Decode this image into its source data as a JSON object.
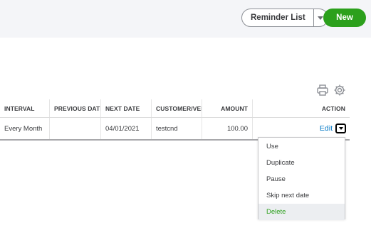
{
  "header": {
    "reminder_label": "Reminder List",
    "new_label": "New"
  },
  "table": {
    "columns": [
      "INTERVAL",
      "PREVIOUS DATE",
      "NEXT DATE",
      "CUSTOMER/VENDOR",
      "AMOUNT",
      "ACTION"
    ],
    "rows": [
      {
        "interval": "Every Month",
        "previous_date": "",
        "next_date": "04/01/2021",
        "customer": "testcnd",
        "amount": "100.00",
        "action": "Edit"
      }
    ]
  },
  "menu": {
    "items": [
      "Use",
      "Duplicate",
      "Pause",
      "Skip next date",
      "Delete"
    ],
    "highlighted": "Delete"
  },
  "colors": {
    "accent": "#2ca01c",
    "link": "#0077c5"
  },
  "icons": [
    "printer-icon",
    "gear-icon",
    "chevron-down-icon"
  ]
}
